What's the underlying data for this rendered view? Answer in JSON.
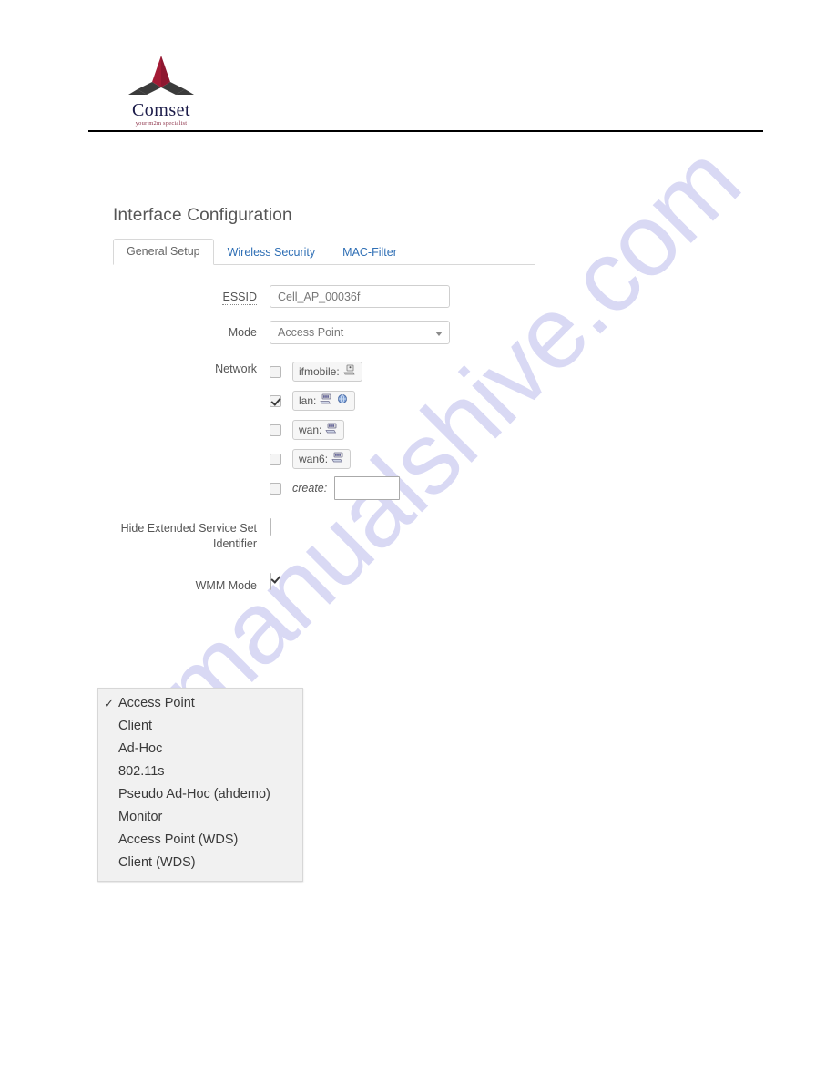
{
  "brand": {
    "name": "Comset",
    "tagline": "your m2m specialist",
    "mark_colors": {
      "red": "#a31b35",
      "dark": "#3b3b3b"
    }
  },
  "watermark": {
    "text": "manualshive.com",
    "color": "#d7d7f4"
  },
  "panel": {
    "title": "Interface Configuration",
    "tabs": [
      {
        "label": "General Setup",
        "active": true
      },
      {
        "label": "Wireless Security",
        "active": false
      },
      {
        "label": "MAC-Filter",
        "active": false
      }
    ],
    "accent_color": "#2f6fb5"
  },
  "form": {
    "essid": {
      "label": "ESSID",
      "value": "Cell_AP_00036f",
      "placeholder": ""
    },
    "mode": {
      "label": "Mode",
      "value": "Access Point"
    },
    "network": {
      "label": "Network",
      "options": [
        {
          "name": "ifmobile:",
          "checked": false,
          "icons": [
            "device-icon"
          ]
        },
        {
          "name": "lan:",
          "checked": true,
          "icons": [
            "ethernet-icon",
            "wifi-icon"
          ]
        },
        {
          "name": "wan:",
          "checked": false,
          "icons": [
            "ethernet-icon"
          ]
        },
        {
          "name": "wan6:",
          "checked": false,
          "icons": [
            "ethernet-icon"
          ]
        }
      ],
      "create": {
        "label": "create:",
        "checked": false,
        "value": "",
        "placeholder": ""
      }
    },
    "hide_essid": {
      "label_line1": "Hide Extended Service Set",
      "label_line2": "Identifier",
      "checked": false
    },
    "wmm": {
      "label": "WMM Mode",
      "checked": true
    }
  },
  "mode_menu": {
    "items": [
      {
        "label": "Access Point",
        "selected": true
      },
      {
        "label": "Client",
        "selected": false
      },
      {
        "label": "Ad-Hoc",
        "selected": false
      },
      {
        "label": "802.11s",
        "selected": false
      },
      {
        "label": "Pseudo Ad-Hoc (ahdemo)",
        "selected": false
      },
      {
        "label": "Monitor",
        "selected": false
      },
      {
        "label": "Access Point (WDS)",
        "selected": false
      },
      {
        "label": "Client (WDS)",
        "selected": false
      }
    ],
    "check_glyph": "✓"
  }
}
